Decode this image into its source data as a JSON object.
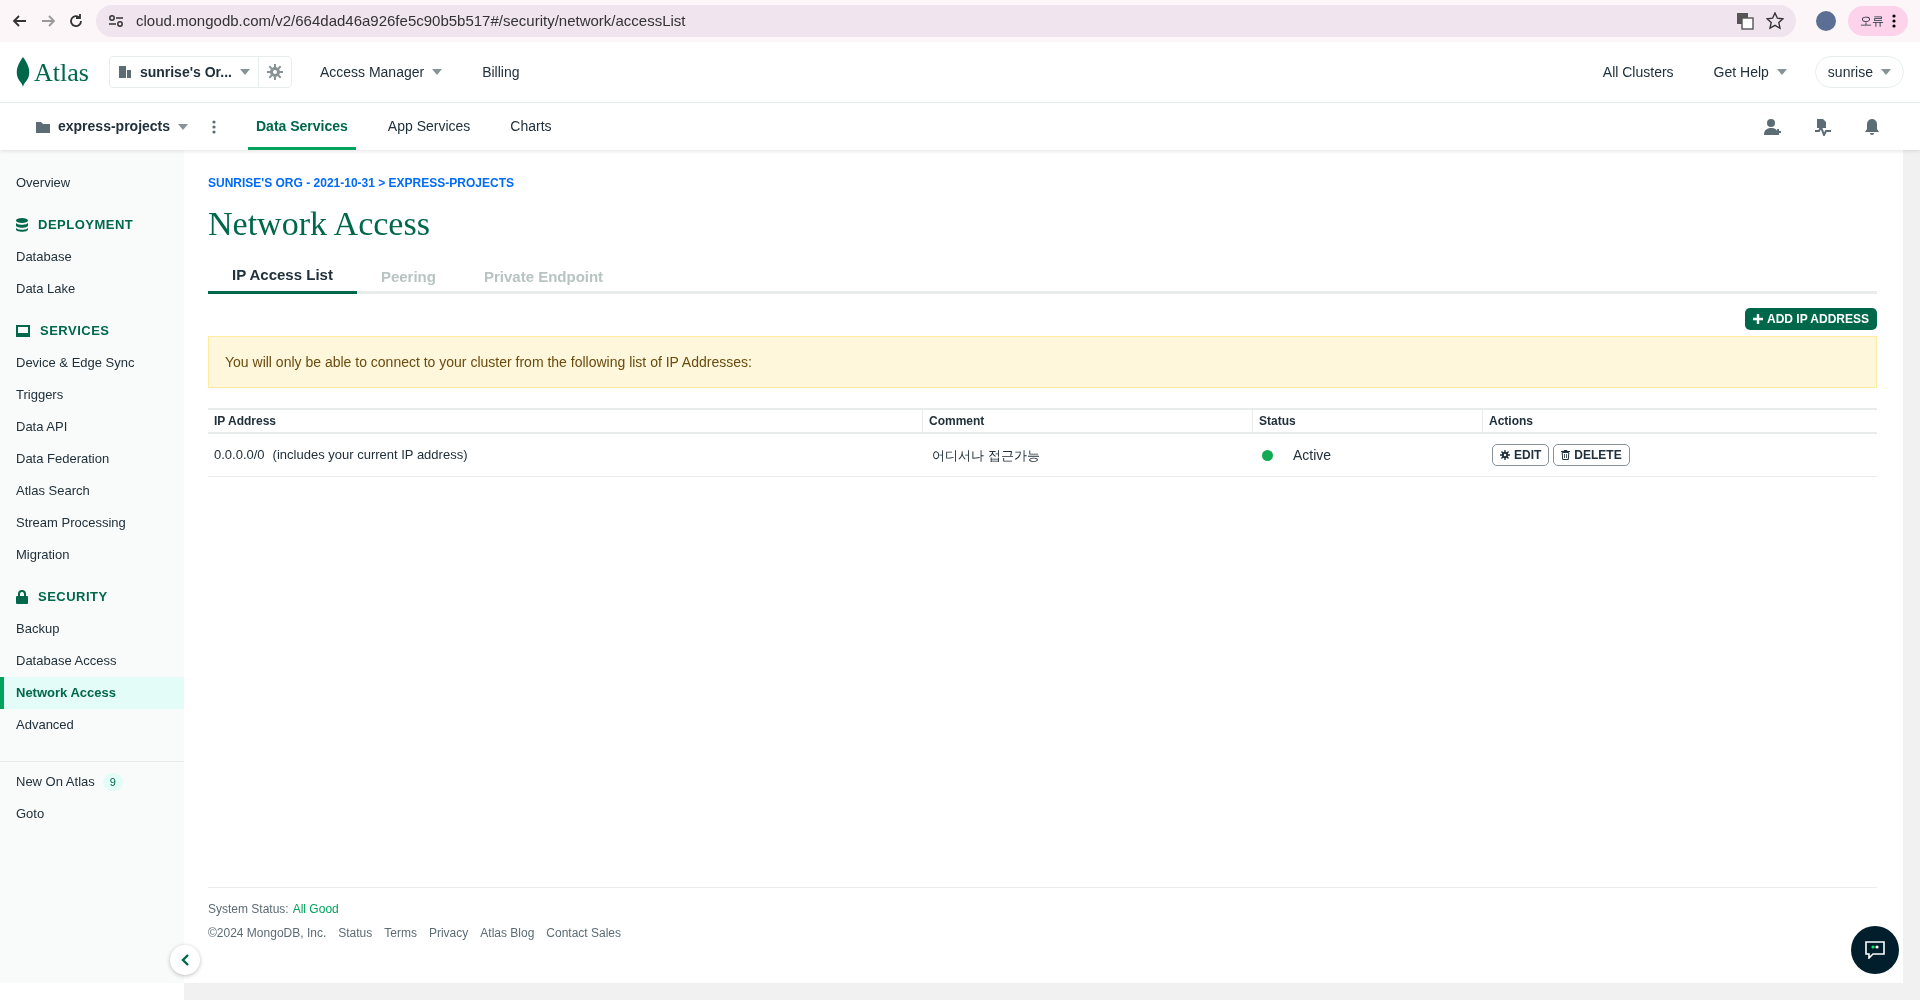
{
  "browser": {
    "url": "cloud.mongodb.com/v2/664dad46a926fe5c90b5b517#/security/network/accessList",
    "profile_badge": "오류"
  },
  "header": {
    "logo": "Atlas",
    "org": "sunrise's Or...",
    "nav": [
      "Access Manager",
      "Billing"
    ],
    "right_links": [
      "All Clusters",
      "Get Help"
    ],
    "user": "sunrise"
  },
  "project_bar": {
    "project": "express-projects",
    "tabs": [
      {
        "label": "Data Services",
        "selected": true
      },
      {
        "label": "App Services",
        "selected": false
      },
      {
        "label": "Charts",
        "selected": false
      }
    ]
  },
  "sidebar": {
    "groups": [
      {
        "items": [
          {
            "label": "Overview",
            "selected": false
          }
        ]
      },
      {
        "heading": "DEPLOYMENT",
        "items": [
          {
            "label": "Database",
            "selected": false
          },
          {
            "label": "Data Lake",
            "selected": false
          }
        ]
      },
      {
        "heading": "SERVICES",
        "items": [
          {
            "label": "Device & Edge Sync",
            "selected": false
          },
          {
            "label": "Triggers",
            "selected": false
          },
          {
            "label": "Data API",
            "selected": false
          },
          {
            "label": "Data Federation",
            "selected": false
          },
          {
            "label": "Atlas Search",
            "selected": false
          },
          {
            "label": "Stream Processing",
            "selected": false
          },
          {
            "label": "Migration",
            "selected": false
          }
        ]
      },
      {
        "heading": "SECURITY",
        "items": [
          {
            "label": "Backup",
            "selected": false
          },
          {
            "label": "Database Access",
            "selected": false
          },
          {
            "label": "Network Access",
            "selected": true
          },
          {
            "label": "Advanced",
            "selected": false
          }
        ]
      }
    ],
    "bottom_items": [
      {
        "label": "New On Atlas",
        "badge": "9"
      },
      {
        "label": "Goto"
      }
    ]
  },
  "page": {
    "breadcrumb": "SUNRISE'S ORG - 2021-10-31 > EXPRESS-PROJECTS",
    "title": "Network Access",
    "tabs": [
      {
        "label": "IP Access List",
        "selected": true
      },
      {
        "label": "Peering",
        "selected": false
      },
      {
        "label": "Private Endpoint",
        "selected": false
      }
    ],
    "add_button": "ADD IP ADDRESS",
    "banner": "You will only be able to connect to your cluster from the following list of IP Addresses:",
    "table": {
      "columns": [
        "IP Address",
        "Comment",
        "Status",
        "Actions"
      ],
      "rows": [
        {
          "ip": "0.0.0.0/0",
          "ip_note": "(includes your current IP address)",
          "comment": "어디서나 접근가능",
          "status": "Active",
          "color": "#13aa52",
          "actions": [
            {
              "kind": "edit",
              "label": "EDIT"
            },
            {
              "kind": "delete",
              "label": "DELETE"
            }
          ]
        }
      ]
    }
  },
  "footer": {
    "status_label": "System Status:",
    "status_value": "All Good",
    "copyright": "©2024 MongoDB, Inc.",
    "links": [
      "Status",
      "Terms",
      "Privacy",
      "Atlas Blog",
      "Contact Sales"
    ]
  }
}
